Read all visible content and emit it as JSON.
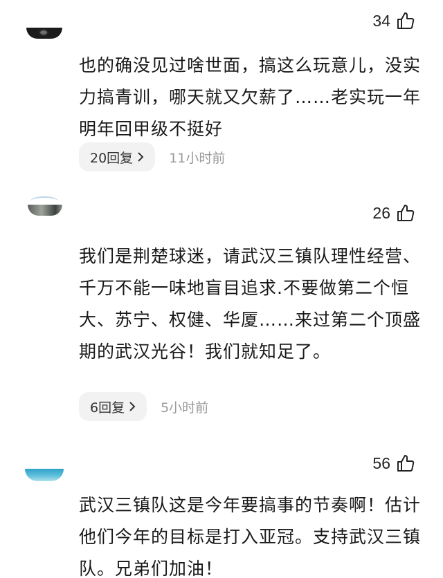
{
  "comments": [
    {
      "likes": "34",
      "text": "也的确没见过啥世面，搞这么玩意儿，没实力搞青训，哪天就又欠薪了……老实玩一年明年回甲级不挺好",
      "reply_label": "20回复",
      "time": "11小时前"
    },
    {
      "likes": "26",
      "text": "我们是荆楚球迷，请武汉三镇队理性经营、千万不能一味地盲目追求.不要做第二个恒大、苏宁、权健、华厦……来过第二个顶盛期的武汉光谷！我们就知足了。",
      "reply_label": "6回复",
      "time": "5小时前"
    },
    {
      "likes": "56",
      "text": "武汉三镇队这是今年要搞事的节奏啊！估计他们今年的目标是打入亚冠。支持武汉三镇队。兄弟们加油！"
    }
  ],
  "icons": {
    "like": "thumbs-up-icon",
    "reply_chevron": "chevron-right-icon"
  }
}
